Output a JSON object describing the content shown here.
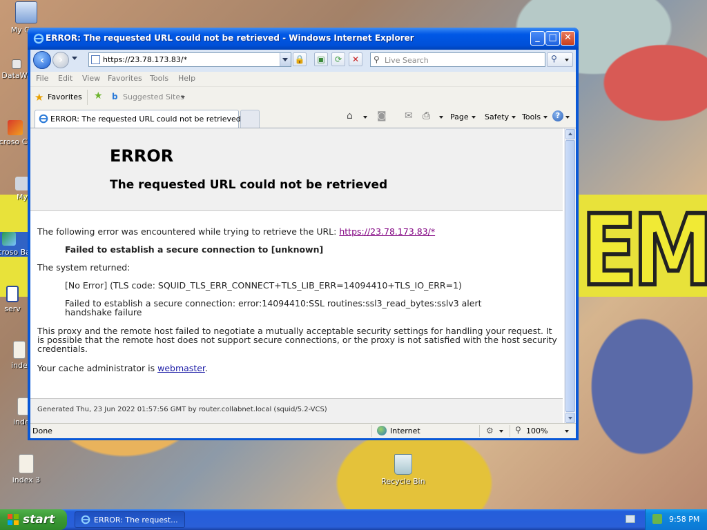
{
  "window": {
    "title": "ERROR: The requested URL could not be retrieved - Windows Internet Explorer",
    "min": "_",
    "max": "□",
    "close": "✕"
  },
  "nav": {
    "url": "https://23.78.173.83/*",
    "search_placeholder": "Live Search"
  },
  "menu": [
    "File",
    "Edit",
    "View",
    "Favorites",
    "Tools",
    "Help"
  ],
  "favorites": {
    "label": "Favorites",
    "suggested": "Suggested Sites"
  },
  "tab": {
    "label": "ERROR: The requested URL could not be retrieved"
  },
  "commands": {
    "page": "Page",
    "safety": "Safety",
    "tools": "Tools",
    "help": "?"
  },
  "page": {
    "heading": "ERROR",
    "subheading": "The requested URL could not be retrieved",
    "intro": "The following error was encountered while trying to retrieve the URL: ",
    "intro_link": "https://23.78.173.83/*",
    "failure": "Failed to establish a secure connection to [unknown]",
    "system_returned": "The system returned:",
    "tls_code": "[No Error] (TLS code: SQUID_TLS_ERR_CONNECT+TLS_LIB_ERR=14094410+TLS_IO_ERR=1)",
    "ssl_error": "Failed to establish a secure connection: error:14094410:SSL routines:ssl3_read_bytes:sslv3 alert handshake failure",
    "explanation": "This proxy and the remote host failed to negotiate a mutually acceptable security settings for handling your request. It is possible that the remote host does not support secure connections, or the proxy is not satisfied with the host security credentials.",
    "admin_prefix": "Your cache administrator is ",
    "admin_link": "webmaster",
    "admin_suffix": ".",
    "footer": "Generated Thu, 23 Jun 2022 01:57:56 GMT by router.collabnet.local (squid/5.2-VCS)"
  },
  "status": {
    "text": "Done",
    "zone": "Internet",
    "zoom": "100%"
  },
  "desktop": {
    "icons": [
      "My Com",
      "DataWa",
      "Microso C++",
      "My",
      "Microso Basic",
      "serv",
      "inde",
      "index",
      "index 3",
      "Recycle Bin"
    ],
    "wallpaper_text": "EMS"
  },
  "taskbar": {
    "start": "start",
    "task": "ERROR: The request...",
    "clock": "9:58 PM"
  },
  "colors": {
    "titlebar": "#0058e6",
    "link_visited": "#800080",
    "link": "#1a1aa6",
    "start": "#3c9a37"
  }
}
